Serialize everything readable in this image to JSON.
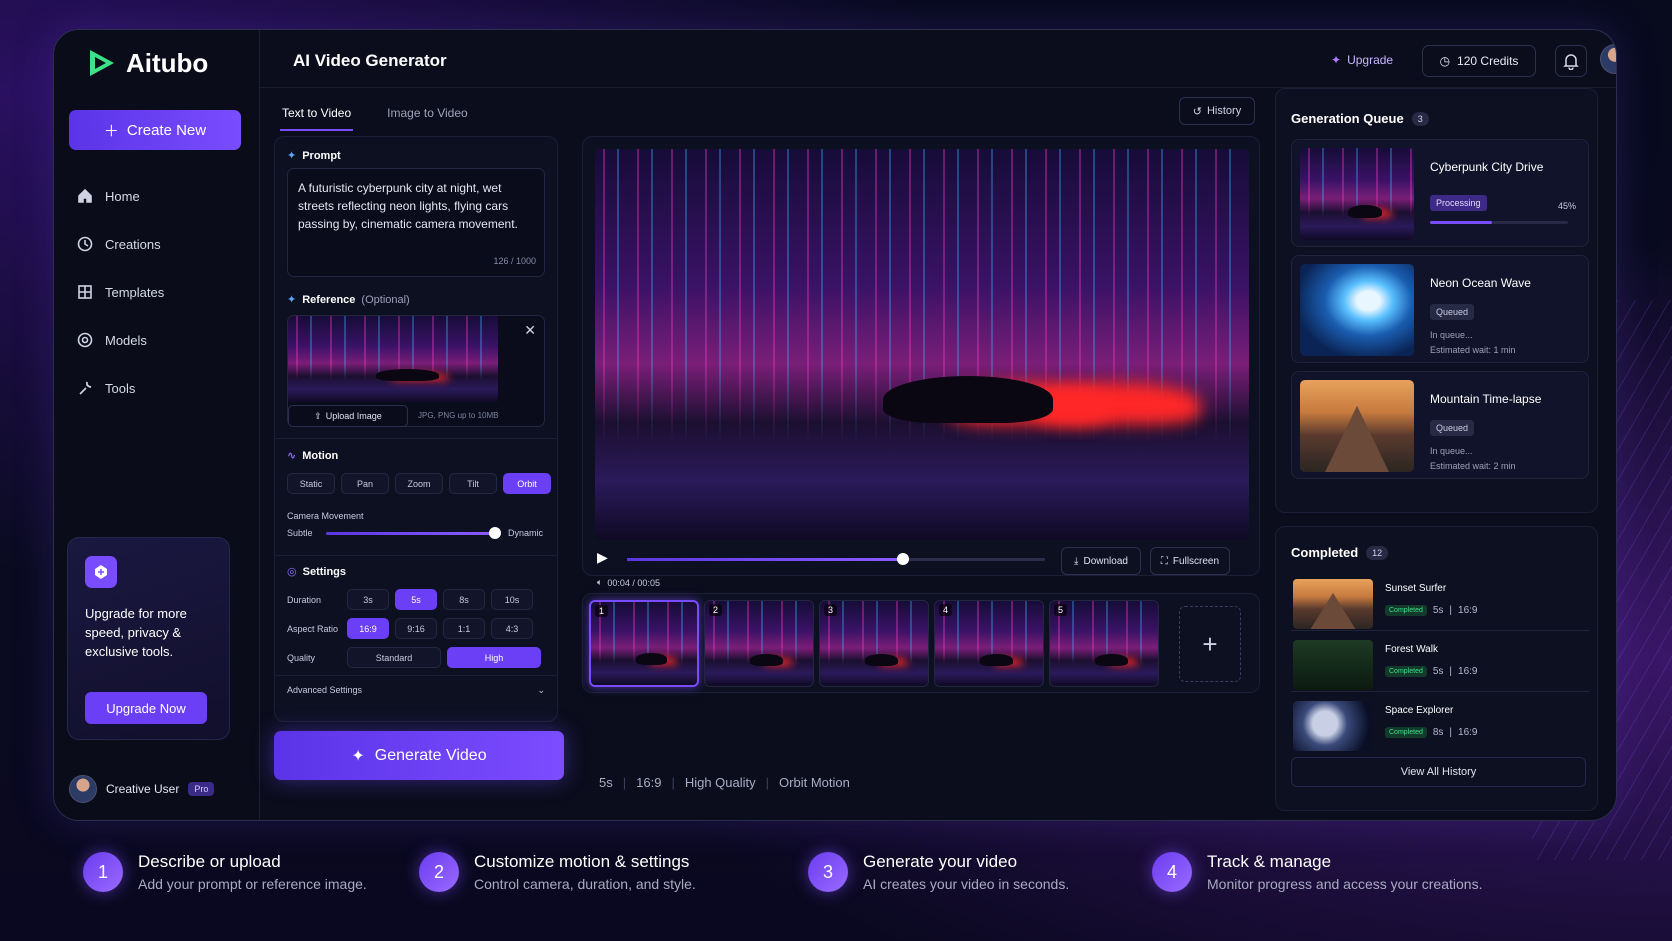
{
  "app": {
    "name": "Aitubo",
    "page_title": "AI Video Generator"
  },
  "sidebar": {
    "create_label": "Create New",
    "items": [
      {
        "label": "Home",
        "icon": "home-icon"
      },
      {
        "label": "Creations",
        "icon": "clock-icon"
      },
      {
        "label": "Templates",
        "icon": "grid-icon"
      },
      {
        "label": "Models",
        "icon": "cube-icon"
      },
      {
        "label": "Tools",
        "icon": "wrench-icon"
      }
    ],
    "upgrade_card": {
      "text": "Upgrade for more speed, privacy & exclusive tools.",
      "button": "Upgrade Now"
    },
    "user": {
      "name": "Creative User",
      "plan": "Pro"
    }
  },
  "header": {
    "upgrade": "Upgrade",
    "credits": "120 Credits"
  },
  "tabs": [
    {
      "label": "Text to Video",
      "active": true
    },
    {
      "label": "Image to Video",
      "active": false
    }
  ],
  "history_label": "History",
  "prompt": {
    "title": "Prompt",
    "text": "A futuristic cyberpunk city at night, wet streets reflecting neon lights, flying cars passing by, cinematic camera movement.",
    "count": "126 / 1000"
  },
  "reference": {
    "title": "Reference",
    "optional": "(Optional)",
    "upload": "Upload Image",
    "hint": "JPG, PNG up to 10MB"
  },
  "motion": {
    "title": "Motion",
    "options": [
      "Static",
      "Pan",
      "Zoom",
      "Tilt",
      "Orbit"
    ],
    "selected": "Orbit",
    "camera_label": "Camera Movement",
    "min_label": "Subtle",
    "max_label": "Dynamic",
    "value": 0.98
  },
  "settings": {
    "title": "Settings",
    "duration_label": "Duration",
    "durations": [
      "3s",
      "5s",
      "8s",
      "10s"
    ],
    "duration_selected": "5s",
    "aspect_label": "Aspect Ratio",
    "aspects": [
      "16:9",
      "9:16",
      "1:1",
      "4:3"
    ],
    "aspect_selected": "16:9",
    "quality_label": "Quality",
    "qualities": [
      "Standard",
      "High"
    ],
    "quality_selected": "High",
    "advanced": "Advanced Settings"
  },
  "generate_label": "Generate Video",
  "player": {
    "time": "00:04 / 00:05",
    "progress": 0.66,
    "download": "Download",
    "fullscreen": "Fullscreen",
    "frames": [
      "1",
      "2",
      "3",
      "4",
      "5"
    ],
    "selected_frame": "1"
  },
  "summary": [
    "5s",
    "16:9",
    "High Quality",
    "Orbit Motion"
  ],
  "queue": {
    "title": "Generation Queue",
    "count": "3",
    "items": [
      {
        "title": "Cyberpunk City Drive",
        "status": "Processing",
        "percent": "45%",
        "progress": 0.45
      },
      {
        "title": "Neon Ocean Wave",
        "status": "Queued",
        "line1": "In queue...",
        "line2": "Estimated wait: 1 min"
      },
      {
        "title": "Mountain Time-lapse",
        "status": "Queued",
        "line1": "In queue...",
        "line2": "Estimated wait: 2 min"
      }
    ]
  },
  "completed": {
    "title": "Completed",
    "count": "12",
    "items": [
      {
        "title": "Sunset Surfer",
        "status": "Completed",
        "duration": "5s",
        "ratio": "16:9"
      },
      {
        "title": "Forest Walk",
        "status": "Completed",
        "duration": "5s",
        "ratio": "16:9"
      },
      {
        "title": "Space Explorer",
        "status": "Completed",
        "duration": "8s",
        "ratio": "16:9"
      }
    ],
    "view_all": "View All History"
  },
  "steps": [
    {
      "num": "1",
      "title": "Describe or upload",
      "desc": "Add your prompt or reference image."
    },
    {
      "num": "2",
      "title": "Customize motion & settings",
      "desc": "Control camera, duration, and style."
    },
    {
      "num": "3",
      "title": "Generate your video",
      "desc": "AI creates your video in seconds."
    },
    {
      "num": "4",
      "title": "Track & manage",
      "desc": "Monitor progress and access your creations."
    }
  ],
  "colors": {
    "accent": "#7a4cff",
    "logo": "#3be28a",
    "completed": "#3be28a"
  }
}
